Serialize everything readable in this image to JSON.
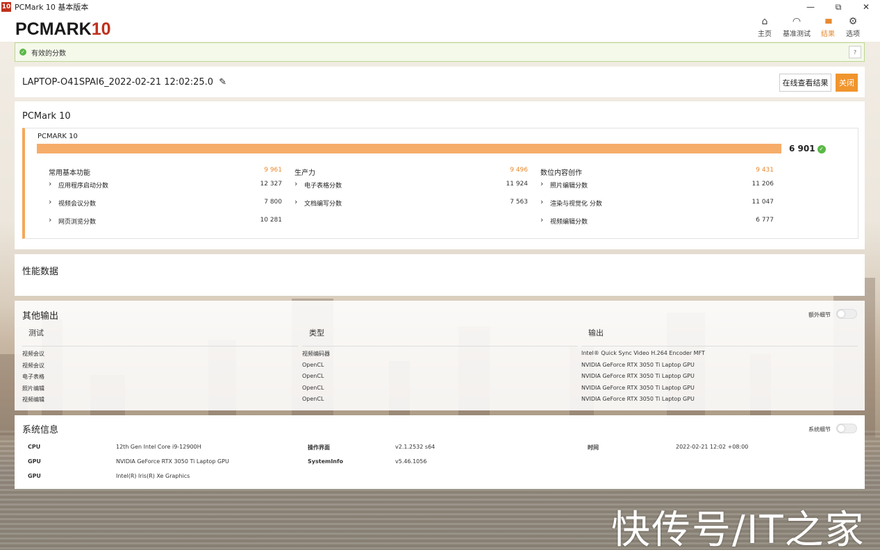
{
  "window": {
    "badge": "10",
    "title": "PCMark 10 基本版本",
    "controls": [
      "—",
      "⧉",
      "✕"
    ]
  },
  "header": {
    "logo_main": "PCMARK",
    "logo_ten": "10",
    "nav": [
      {
        "label": "主页",
        "icon": "⌂",
        "active": false
      },
      {
        "label": "基准测试",
        "icon": "◠",
        "active": false
      },
      {
        "label": "结果",
        "icon": "▮▮▮",
        "active": true
      },
      {
        "label": "选项",
        "icon": "⚙",
        "active": false
      }
    ]
  },
  "validity": {
    "text": "有效的分数",
    "help": "?"
  },
  "result": {
    "name": "LAPTOP-O41SPAI6_2022-02-21 12:02:25.0",
    "edit_icon": "✎",
    "online_button": "在线查看结果",
    "close_button": "关闭"
  },
  "pcmark": {
    "section_title": "PCMark 10",
    "card_title": "PCMARK 10",
    "total_score": "6 901",
    "score_fill": 1.0,
    "groups": [
      {
        "name": "常用基本功能",
        "score": "9 961",
        "items": [
          {
            "name": "应用程序启动分数",
            "score": "12 327"
          },
          {
            "name": "视频会议分数",
            "score": "7 800"
          },
          {
            "name": "网页浏览分数",
            "score": "10 281"
          }
        ]
      },
      {
        "name": "生产力",
        "score": "9 496",
        "items": [
          {
            "name": "电子表格分数",
            "score": "11 924"
          },
          {
            "name": "文档编写分数",
            "score": "7 563"
          }
        ]
      },
      {
        "name": "数位内容创作",
        "score": "9 431",
        "items": [
          {
            "name": "照片编辑分数",
            "score": "11 206"
          },
          {
            "name": "渲染与视觉化 分数",
            "score": "11 047"
          },
          {
            "name": "视频编辑分数",
            "score": "6 777"
          }
        ]
      }
    ]
  },
  "performance": {
    "title": "性能数据"
  },
  "other_output": {
    "title": "其他输出",
    "toggle_label": "额外细节",
    "columns": [
      "测试",
      "类型",
      "输出"
    ],
    "rows": [
      [
        "视频会议",
        "视频编码器",
        "Intel® Quick Sync Video H.264 Encoder MFT"
      ],
      [
        "视频会议",
        "OpenCL",
        "NVIDIA GeForce RTX 3050 Ti Laptop GPU"
      ],
      [
        "电子表格",
        "OpenCL",
        "NVIDIA GeForce RTX 3050 Ti Laptop GPU"
      ],
      [
        "照片编辑",
        "OpenCL",
        "NVIDIA GeForce RTX 3050 Ti Laptop GPU"
      ],
      [
        "视频编辑",
        "OpenCL",
        "NVIDIA GeForce RTX 3050 Ti Laptop GPU"
      ]
    ]
  },
  "system_info": {
    "title": "系统信息",
    "toggle_label": "系统细节",
    "col1": [
      {
        "k": "CPU",
        "v": "12th Gen Intel Core i9-12900H"
      },
      {
        "k": "GPU",
        "v": "NVIDIA GeForce RTX 3050 Ti Laptop GPU"
      },
      {
        "k": "GPU",
        "v": "Intel(R) Iris(R) Xe Graphics"
      }
    ],
    "col2": [
      {
        "k": "操作界面",
        "v": "v2.1.2532 s64"
      },
      {
        "k": "SystemInfo",
        "v": "v5.46.1056"
      }
    ],
    "col3": [
      {
        "k": "时间",
        "v": "2022-02-21 12:02 +08:00"
      }
    ]
  },
  "watermark": "快传号/IT之家",
  "colors": {
    "accent": "#f0952e",
    "score_bar": "#f7ad6a",
    "valid_green": "#5ab847",
    "brand_red": "#c0311c"
  }
}
